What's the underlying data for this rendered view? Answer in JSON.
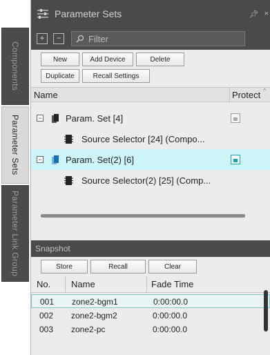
{
  "side_tabs": [
    {
      "label": "Components"
    },
    {
      "label": "Parameter Sets"
    },
    {
      "label": "Parameter Link Group"
    }
  ],
  "panel": {
    "title": "Parameter Sets",
    "filter_placeholder": "Filter"
  },
  "buttons": {
    "new": "New",
    "add_device": "Add Device",
    "delete": "Delete",
    "duplicate": "Duplicate",
    "recall_settings": "Recall Settings"
  },
  "tree": {
    "col_name": "Name",
    "col_protect": "Protect",
    "rows": [
      {
        "label": "Param. Set [4]",
        "kind": "set",
        "selected": false
      },
      {
        "label": "Source Selector [24] (Compo...",
        "kind": "device",
        "selected": false
      },
      {
        "label": "Param. Set(2) [6]",
        "kind": "set",
        "selected": true
      },
      {
        "label": "Source Selector(2) [25] (Comp...",
        "kind": "device",
        "selected": false
      }
    ]
  },
  "snapshot": {
    "title": "Snapshot",
    "store": "Store",
    "recall": "Recall",
    "clear": "Clear",
    "col_no": "No.",
    "col_name": "Name",
    "col_fade": "Fade Time",
    "rows": [
      {
        "no": "001",
        "name": "zone2-bgm1",
        "fade": "0:00:00.0"
      },
      {
        "no": "002",
        "name": "zone2-bgm2",
        "fade": "0:00:00.0"
      },
      {
        "no": "003",
        "name": "zone2-pc",
        "fade": "0:00:00.0"
      }
    ]
  },
  "colors": {
    "selected_row": "#cdf6fb",
    "accent": "#1a9fb8",
    "header_dark": "#4a4a4a"
  }
}
